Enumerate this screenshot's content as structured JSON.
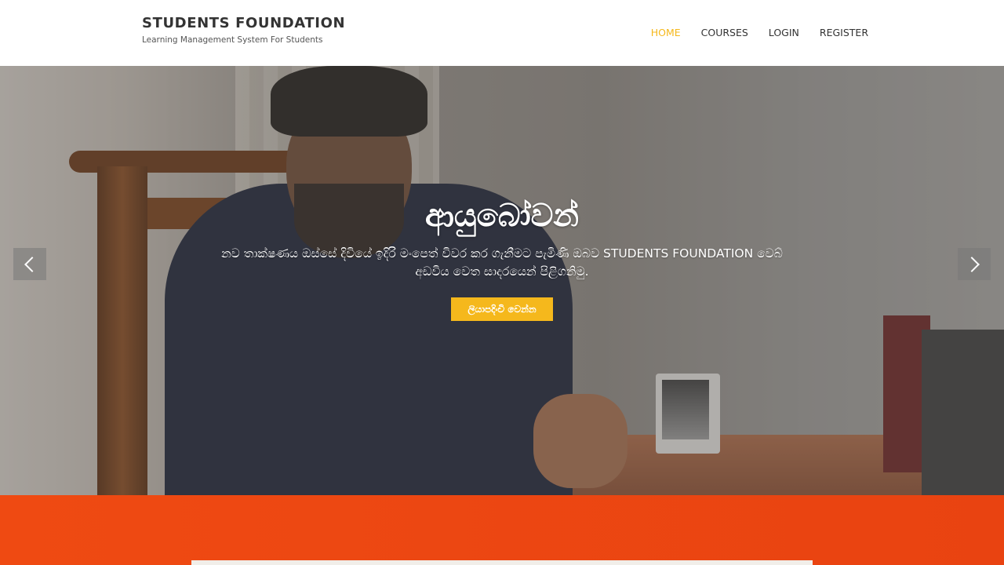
{
  "header": {
    "brand_title": "STUDENTS FOUNDATION",
    "brand_tagline": "Learning Management System For Students",
    "nav": [
      {
        "label": "HOME",
        "active": true
      },
      {
        "label": "COURSES",
        "active": false
      },
      {
        "label": "LOGIN",
        "active": false
      },
      {
        "label": "REGISTER",
        "active": false
      }
    ]
  },
  "hero": {
    "title": "ආයුබෝවන්",
    "subtitle": "නව තාක්ෂණය ඔස්සේ දිවියේ ඉදිරි මංපෙත් විවර කර ගැනීමට පැමිණි ඔබව STUDENTS FOUNDATION වෙබ් අඩවිය වෙත සාදරයෙන් පිළිගනිමු.",
    "button_label": "ලියාපදිංචි වෙන්න",
    "prev_icon": "chevron-left-icon",
    "next_icon": "chevron-right-icon"
  },
  "colors": {
    "accent": "#f5b81c",
    "section_orange": "#ec4712",
    "text_dark": "#333333"
  }
}
